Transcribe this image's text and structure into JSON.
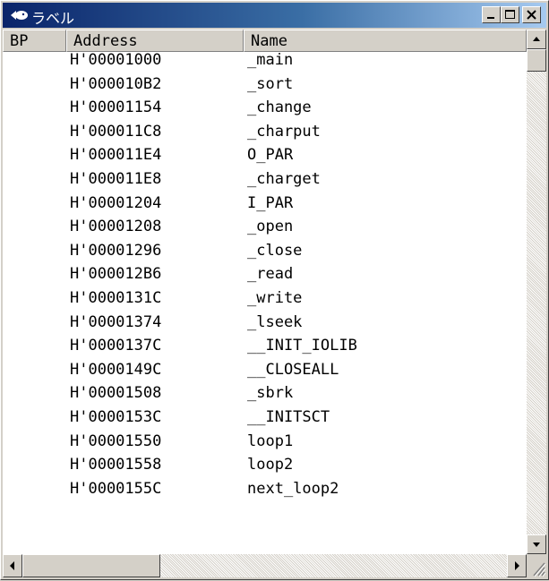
{
  "window": {
    "title": "ラベル"
  },
  "columns": {
    "bp": "BP",
    "address": "Address",
    "name": "Name"
  },
  "rows": [
    {
      "address": "H'00001000",
      "name": "_main"
    },
    {
      "address": "H'000010B2",
      "name": "_sort"
    },
    {
      "address": "H'00001154",
      "name": "_change"
    },
    {
      "address": "H'000011C8",
      "name": "_charput"
    },
    {
      "address": "H'000011E4",
      "name": "O_PAR"
    },
    {
      "address": "H'000011E8",
      "name": "_charget"
    },
    {
      "address": "H'00001204",
      "name": "I_PAR"
    },
    {
      "address": "H'00001208",
      "name": "_open"
    },
    {
      "address": "H'00001296",
      "name": "_close"
    },
    {
      "address": "H'000012B6",
      "name": "_read"
    },
    {
      "address": "H'0000131C",
      "name": "_write"
    },
    {
      "address": "H'00001374",
      "name": "_lseek"
    },
    {
      "address": "H'0000137C",
      "name": "__INIT_IOLIB"
    },
    {
      "address": "H'0000149C",
      "name": "__CLOSEALL"
    },
    {
      "address": "H'00001508",
      "name": "_sbrk"
    },
    {
      "address": "H'0000153C",
      "name": "__INITSCT"
    },
    {
      "address": "H'00001550",
      "name": "loop1"
    },
    {
      "address": "H'00001558",
      "name": "loop2"
    },
    {
      "address": "H'0000155C",
      "name": "next_loop2"
    }
  ],
  "icons": {
    "app": "label-app-icon",
    "minimize": "minimize-icon",
    "maximize": "maximize-icon",
    "close": "close-icon",
    "scroll_up": "arrow-up-icon",
    "scroll_down": "arrow-down-icon",
    "scroll_left": "arrow-left-icon",
    "scroll_right": "arrow-right-icon",
    "grip": "resize-grip-icon"
  },
  "colors": {
    "title_start": "#0a246a",
    "title_end": "#a6caf0",
    "face": "#d4d0c8"
  }
}
